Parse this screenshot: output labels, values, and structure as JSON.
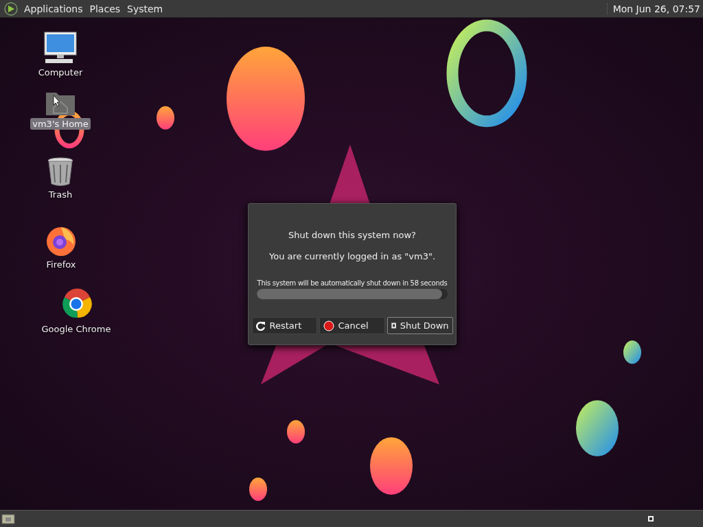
{
  "top_panel": {
    "menus": [
      {
        "label": "Applications"
      },
      {
        "label": "Places"
      },
      {
        "label": "System"
      }
    ],
    "clock": "Mon Jun 26, 07:57"
  },
  "desktop_icons": [
    {
      "label": "Computer",
      "kind": "computer",
      "selected": false
    },
    {
      "label": "vm3's Home",
      "kind": "home",
      "selected": true
    },
    {
      "label": "Trash",
      "kind": "trash",
      "selected": false
    },
    {
      "label": "Firefox",
      "kind": "firefox",
      "selected": false
    },
    {
      "label": "Google Chrome",
      "kind": "chrome",
      "selected": false
    }
  ],
  "dialog": {
    "question": "Shut down this system now?",
    "message": "You are currently logged in as \"vm3\".",
    "countdown": "This system will be automatically shut down in 58 seconds",
    "progress": {
      "level": 0.97
    },
    "buttons": [
      {
        "label": "Restart",
        "kind": "restart",
        "selected": false
      },
      {
        "label": "Cancel",
        "kind": "cancel",
        "selected": false
      },
      {
        "label": "Shut Down",
        "kind": "shutdown",
        "selected": true
      }
    ]
  }
}
